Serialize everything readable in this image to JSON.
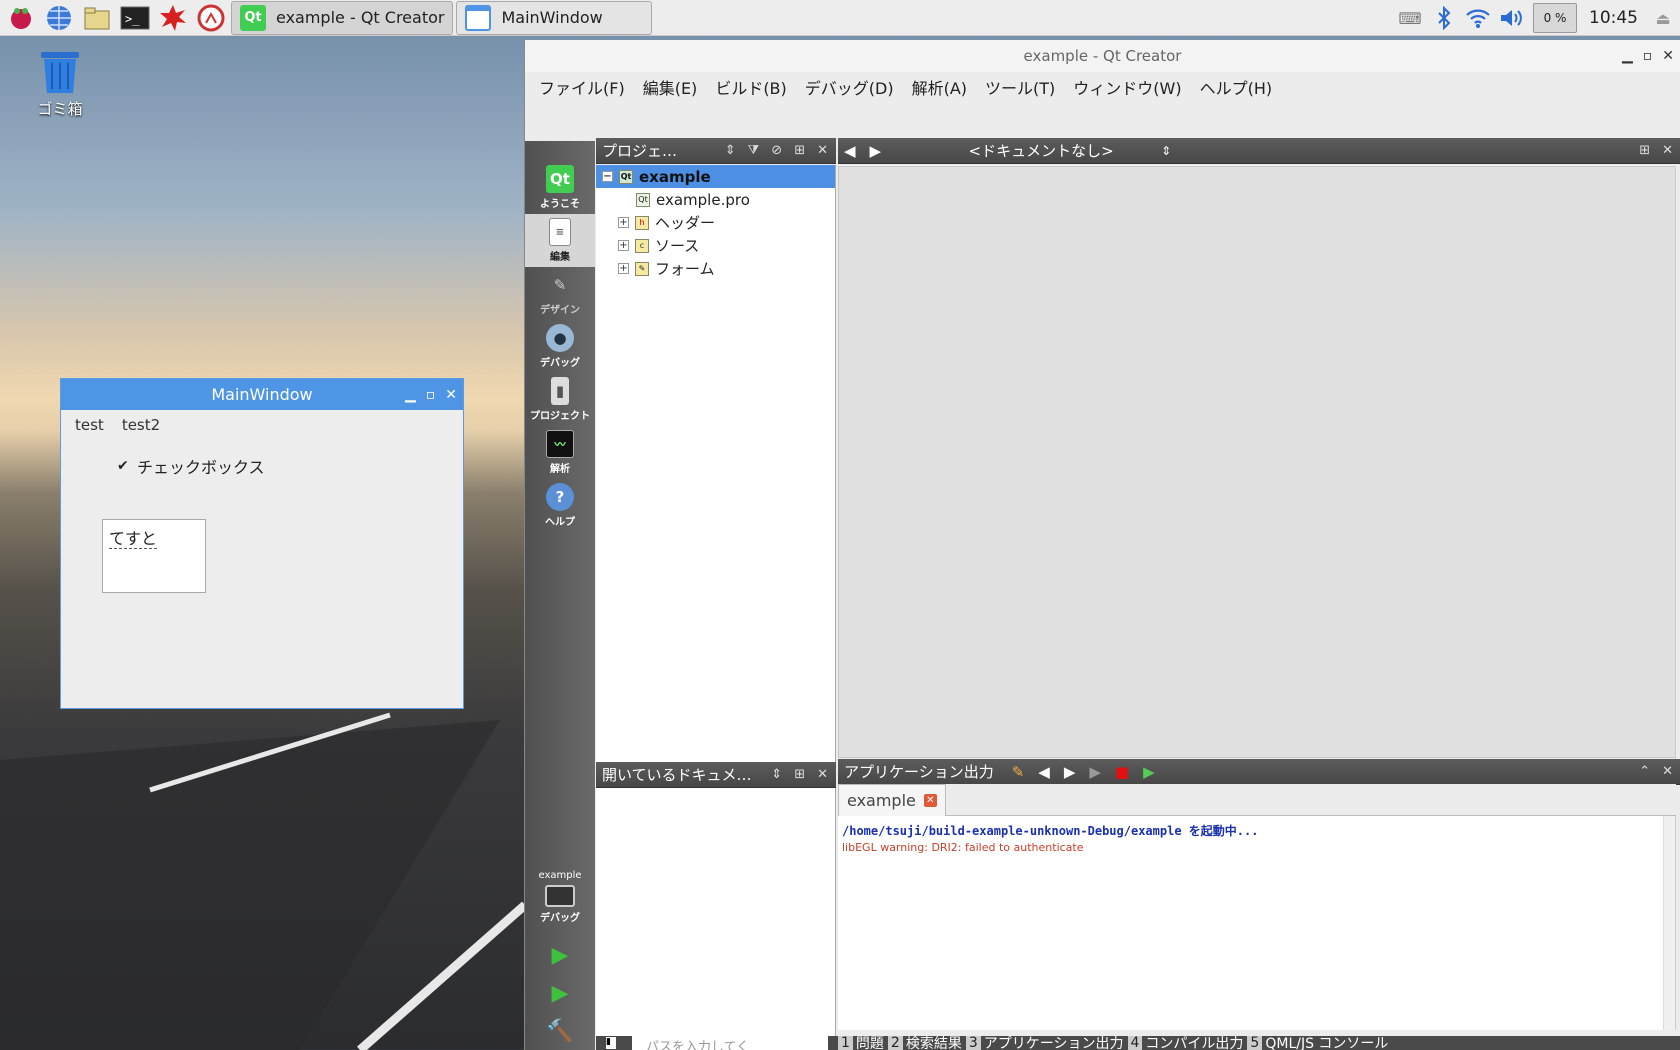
{
  "taskbar": {
    "tasks": [
      {
        "label": "example - Qt Creator",
        "active": true
      },
      {
        "label": "MainWindow",
        "active": false
      }
    ],
    "cpu": "0 %",
    "clock": "10:45"
  },
  "desktop": {
    "trash_label": "ゴミ箱"
  },
  "mainwindow": {
    "title": "MainWindow",
    "menu": [
      "test",
      "test2"
    ],
    "checkbox_label": "チェックボックス",
    "checkbox_checked": true,
    "textbox_value": "てすと"
  },
  "qtcreator": {
    "title": "example - Qt Creator",
    "menu": [
      "ファイル(F)",
      "編集(E)",
      "ビルド(B)",
      "デバッグ(D)",
      "解析(A)",
      "ツール(T)",
      "ウィンドウ(W)",
      "ヘルプ(H)"
    ],
    "modes": [
      "ようこそ",
      "編集",
      "デザイン",
      "デバッグ",
      "プロジェクト",
      "解析",
      "ヘルプ"
    ],
    "kit": {
      "project": "example",
      "label": "デバッグ"
    },
    "project_pane_title": "プロジェ…",
    "document_selector": "<ドキュメントなし>",
    "tree": [
      {
        "label": "example",
        "level": 0,
        "selected": true
      },
      {
        "label": "example.pro",
        "level": 1
      },
      {
        "label": "ヘッダー",
        "level": 1
      },
      {
        "label": "ソース",
        "level": 1
      },
      {
        "label": "フォーム",
        "level": 1
      }
    ],
    "open_docs_title": "開いているドキュメ…",
    "output_title": "アプリケーション出力",
    "output_tab": "example",
    "output_lines": [
      {
        "text": "/home/tsuji/build-example-unknown-Debug/example を起動中...",
        "color": "#1a30b0"
      },
      {
        "text": "libEGL warning: DRI2: failed to authenticate",
        "color": "#c8402a"
      }
    ],
    "status": {
      "search_placeholder": "パスを入力してく",
      "panes": [
        {
          "num": "1",
          "label": "問題"
        },
        {
          "num": "2",
          "label": "検索結果"
        },
        {
          "num": "3",
          "label": "アプリケーション出力"
        },
        {
          "num": "4",
          "label": "コンパイル出力"
        },
        {
          "num": "5",
          "label": "QML/JS コンソール"
        }
      ]
    }
  }
}
